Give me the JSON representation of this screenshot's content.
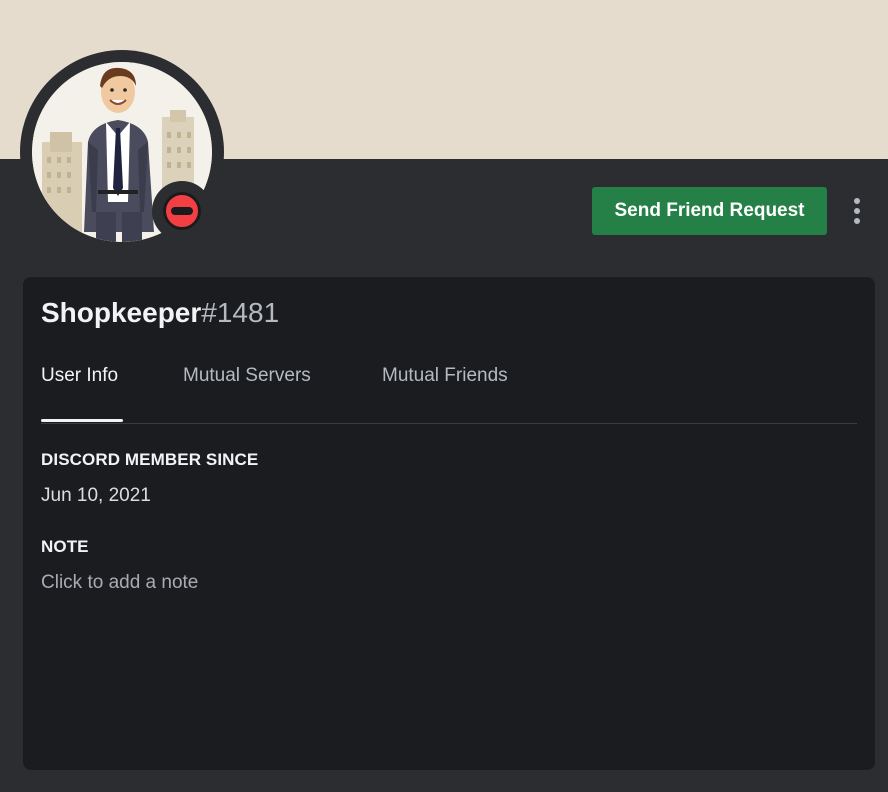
{
  "profile": {
    "username": "Shopkeeper",
    "discriminator": "#1481",
    "status": "do-not-disturb",
    "banner_color": "#e5dccd",
    "avatar": "businessman-avatar"
  },
  "actions": {
    "send_friend_request_label": "Send Friend Request",
    "more_icon": "more-vertical-icon",
    "button_color": "#248046"
  },
  "tabs": [
    {
      "label": "User Info",
      "active": true
    },
    {
      "label": "Mutual Servers",
      "active": false
    },
    {
      "label": "Mutual Friends",
      "active": false
    }
  ],
  "user_info": {
    "member_since_title": "DISCORD MEMBER SINCE",
    "member_since_value": "Jun 10, 2021",
    "note_title": "NOTE",
    "note_placeholder": "Click to add a note"
  }
}
